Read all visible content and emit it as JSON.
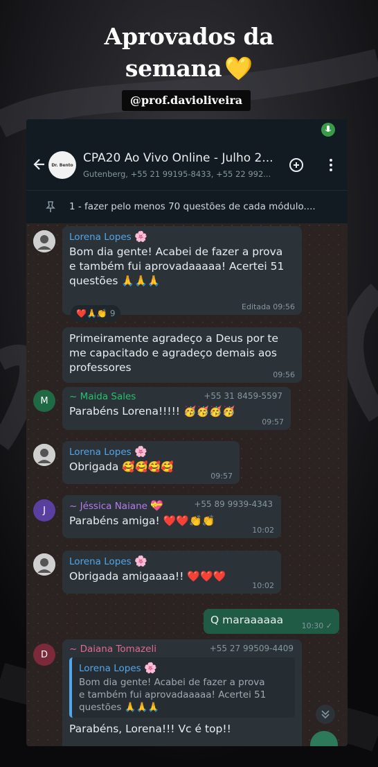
{
  "story": {
    "title_line1": "Aprovados da",
    "title_line2": "semana",
    "title_emoji": "💛",
    "handle": "@prof.davioliveira"
  },
  "header": {
    "group_name": "CPA20 Ao Vivo Online - Julho 2...",
    "members": "Gutenberg, +55 21 99195-8433, +55 22 992...",
    "avatar_text": "Dr. Bento"
  },
  "pinned": {
    "text": "1 - fazer pelo menos 70 questões de cada módulo...."
  },
  "messages": [
    {
      "sender": "Lorena Lopes",
      "sender_emoji": "🌸",
      "text_line1": "Bom dia gente! Acabei de fazer a prova",
      "text_line2": "e também fui aprovadaaaaa! Acertei 51",
      "text_line3": "questões",
      "text_emoji": "🙏🙏🙏",
      "time": "Editada 09:56",
      "reactions": "❤️🙏👏",
      "reaction_count": "9"
    },
    {
      "text_line1": "Primeiramente agradeço a Deus por te",
      "text_line2": "me capacitado e agradeço demais aos",
      "text_line3": "professores",
      "time": "09:56"
    },
    {
      "avatar_letter": "M",
      "sender": "~ Maida Sales",
      "phone": "+55 31 8459-5597",
      "text": "Parabéns Lorena!!!!!",
      "text_emoji": "🥳🥳🥳🥳",
      "time": "09:57"
    },
    {
      "sender": "Lorena Lopes",
      "sender_emoji": "🌸",
      "text": "Obrigada",
      "text_emoji": "🥰🥰🥰🥰",
      "time": "09:57"
    },
    {
      "avatar_letter": "J",
      "sender": "~ Jéssica Naiane",
      "sender_emoji": "💝",
      "phone": "+55 89 9939-4343",
      "text": "Parabéns amiga!",
      "text_emoji": "❤️❤️👏👏",
      "time": "10:02"
    },
    {
      "sender": "Lorena Lopes",
      "sender_emoji": "🌸",
      "text": "Obrigada amigaaaa!!",
      "text_emoji": "❤️❤️❤️",
      "time": "10:02"
    },
    {
      "text": "Q maraaaaaa",
      "time": "10:30 ✓"
    },
    {
      "avatar_letter": "D",
      "sender": "~ Daiana Tomazeli",
      "phone": "+55 27 99509-4409",
      "quote_name": "Lorena Lopes",
      "quote_emoji": "🌸",
      "quote_line1": "Bom dia gente! Acabei de fazer a prova",
      "quote_line2": "e também fui aprovadaaaaa! Acertei 51",
      "quote_line3": "questões",
      "quote_emoji_tail": "🙏🙏🙏",
      "text": "Parabéns, Lorena!!! Vc é top!!"
    }
  ],
  "colors": {
    "chat_bg": "#2a2322",
    "bubble_in": "#2b3238",
    "bubble_out": "#1f5b45",
    "link_blue": "#53a6e8"
  }
}
